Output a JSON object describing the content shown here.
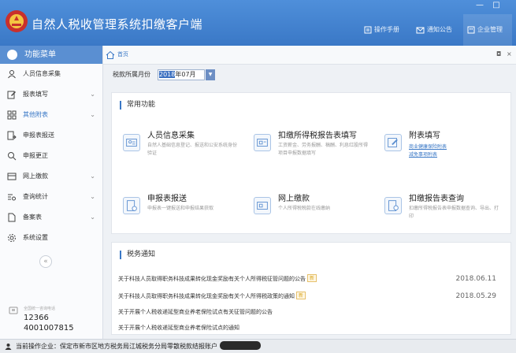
{
  "app": {
    "title": "自然人税收管理系统扣缴客户端",
    "window_controls": [
      "—",
      "□"
    ],
    "links": {
      "manual": "操作手册",
      "notice": "通知公告",
      "enterprise": "企业管理"
    }
  },
  "sidebar": {
    "header": "功能菜单",
    "items": [
      {
        "label": "人员信息采集",
        "icon": "person-icon",
        "has_chevron": false
      },
      {
        "label": "报表填写",
        "icon": "edit-icon",
        "has_chevron": true
      },
      {
        "label": "其他附表",
        "icon": "grid-icon",
        "has_chevron": true
      },
      {
        "label": "申报表报送",
        "icon": "submit-icon",
        "has_chevron": false
      },
      {
        "label": "申报更正",
        "icon": "search-icon",
        "has_chevron": false
      },
      {
        "label": "网上缴款",
        "icon": "card-icon",
        "has_chevron": true
      },
      {
        "label": "查询统计",
        "icon": "stats-icon",
        "has_chevron": true
      },
      {
        "label": "备案表",
        "icon": "file-icon",
        "has_chevron": true
      },
      {
        "label": "系统设置",
        "icon": "gear-icon",
        "has_chevron": false
      }
    ],
    "collapse": "«",
    "hotline": {
      "label": "全国统一咨询电话",
      "numbers": [
        "12366",
        "4001007815"
      ]
    }
  },
  "tabs": {
    "home": "首页",
    "controls": [
      "◘",
      "×"
    ]
  },
  "period": {
    "label": "税款所属月份",
    "year": "2018",
    "month": "年07月",
    "button": "▼"
  },
  "common": {
    "title": "常用功能",
    "cards": [
      {
        "name": "人员信息采集",
        "desc": "自然人基础信息登记、报送和公安系统身份验证",
        "icon": "person-card-icon"
      },
      {
        "name": "扣缴所得税报告表填写",
        "desc": "工资薪金、劳务报酬、稿酬、利息红股所得项目申报数据填写",
        "icon": "report-card-icon"
      },
      {
        "name": "附表填写",
        "desc": "",
        "links": [
          "商业健康保险附表",
          "减免事项附表"
        ],
        "icon": "edit-card-icon"
      },
      {
        "name": "申报表报送",
        "desc": "申报表一键报送和申报结果获取",
        "icon": "send-card-icon"
      },
      {
        "name": "网上缴款",
        "desc": "个人所得税税款在线缴纳",
        "icon": "pay-card-icon"
      },
      {
        "name": "扣缴报告表查询",
        "desc": "扣缴所得税报告表申报数据查询、导出、打印",
        "icon": "query-card-icon"
      }
    ]
  },
  "notices": {
    "title": "税务通知",
    "badge": "新",
    "rows": [
      {
        "text": "关于科技人员取得职务科技成果转化现金奖励有关个人所得税征管问题的公告",
        "new": true,
        "date": "2018.06.11"
      },
      {
        "text": "关于科技人员取得职务科技成果转化现金奖励有关个人所得税政策的通知",
        "new": true,
        "date": "2018.05.29"
      },
      {
        "text": "关于开展个人税收递延型商业养老保险试点有关征管问题的公告",
        "new": false,
        "date": ""
      },
      {
        "text": "关于开展个人税收递延型商业养老保险试点的通知",
        "new": false,
        "date": ""
      }
    ]
  },
  "status": {
    "text": "当前操作企业：保定市新市区地方税务局江城税务分局零散税款结报账户"
  },
  "colors": {
    "primary": "#3a78c6",
    "badge": "#d9a41c"
  }
}
